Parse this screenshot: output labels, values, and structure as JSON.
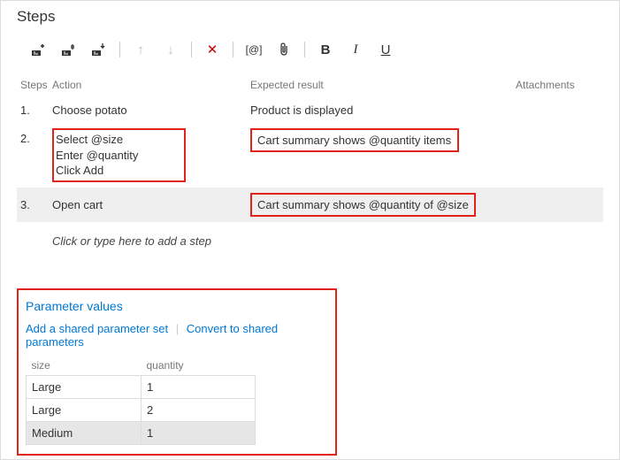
{
  "title": "Steps",
  "headers": {
    "steps": "Steps",
    "action": "Action",
    "expected": "Expected result",
    "attachments": "Attachments"
  },
  "rows": [
    {
      "num": "1.",
      "action": "Choose potato",
      "result": "Product is displayed"
    },
    {
      "num": "2.",
      "action": "Select @size\nEnter @quantity\nClick Add",
      "result": "Cart summary shows @quantity items"
    },
    {
      "num": "3.",
      "action": "Open cart",
      "result": "Cart summary shows @quantity of @size"
    }
  ],
  "placeholder": "Click or type here to add a step",
  "params": {
    "title": "Parameter values",
    "link_add": "Add a shared parameter set",
    "link_convert": "Convert to shared parameters",
    "cols": {
      "size": "size",
      "quantity": "quantity"
    },
    "rows": [
      {
        "size": "Large",
        "quantity": "1"
      },
      {
        "size": "Large",
        "quantity": "2"
      },
      {
        "size": "Medium",
        "quantity": "1"
      }
    ]
  },
  "toolbar": {
    "b": "B",
    "i": "I",
    "u": "U",
    "at": "[@]",
    "x": "✕",
    "up": "↑",
    "down": "↓"
  }
}
